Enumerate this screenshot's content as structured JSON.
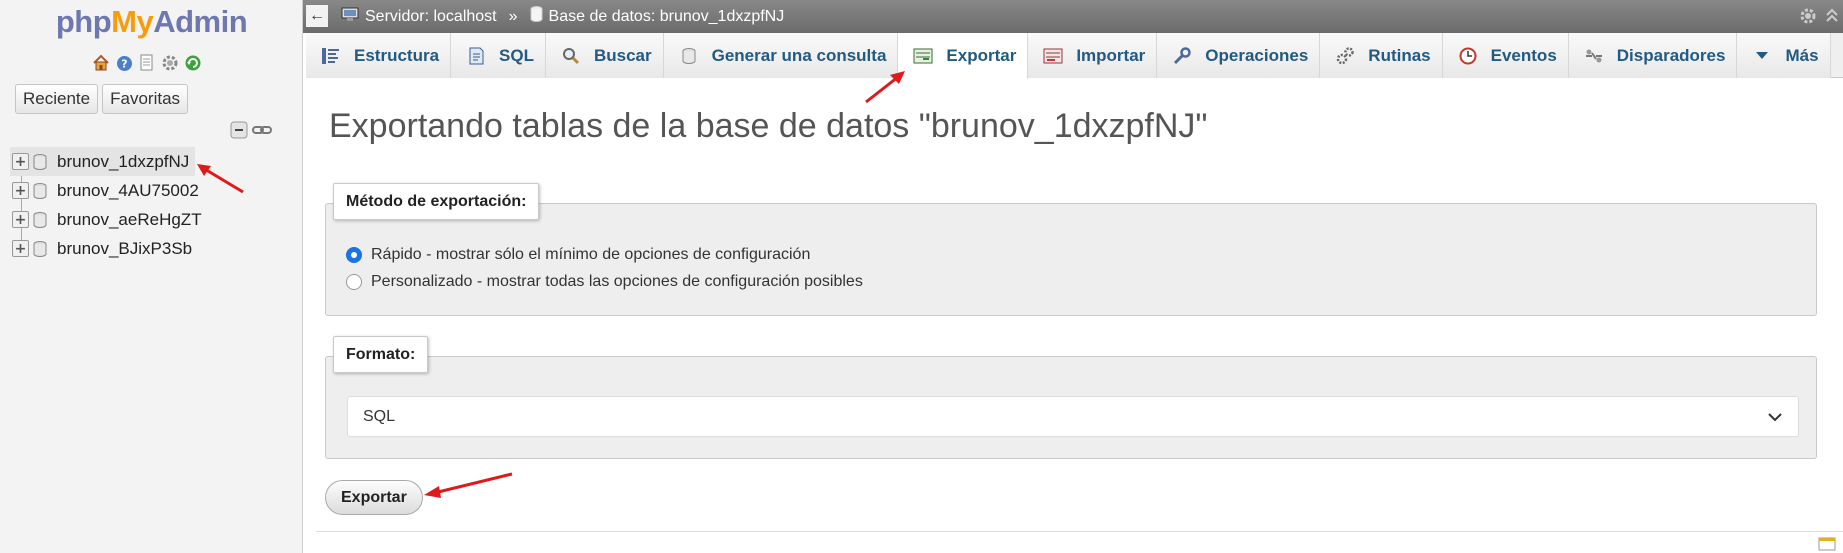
{
  "nav": {
    "logo": {
      "php": "php",
      "my": "My",
      "admin": "Admin"
    },
    "icons": [
      "home-icon",
      "help-icon",
      "docs-icon",
      "settings-icon",
      "reload-icon"
    ],
    "buttons": {
      "recent": "Reciente",
      "favorites": "Favoritas"
    },
    "tree_controls": [
      "collapse-all-icon",
      "link-icon"
    ],
    "databases": [
      {
        "name": "brunov_1dxzpfNJ",
        "active": true
      },
      {
        "name": "brunov_4AU75002",
        "active": false
      },
      {
        "name": "brunov_aeReHgZT",
        "active": false
      },
      {
        "name": "brunov_BJixP3Sb",
        "active": false
      }
    ]
  },
  "breadcrumb": {
    "server_label": "Servidor: localhost",
    "separator": "»",
    "database_label": "Base de datos: brunov_1dxzpfNJ"
  },
  "tabs": [
    {
      "label": "Estructura",
      "icon": "structure-icon",
      "active": false
    },
    {
      "label": "SQL",
      "icon": "sql-icon",
      "active": false
    },
    {
      "label": "Buscar",
      "icon": "search-icon",
      "active": false
    },
    {
      "label": "Generar una consulta",
      "icon": "query-icon",
      "active": false
    },
    {
      "label": "Exportar",
      "icon": "export-icon",
      "active": true
    },
    {
      "label": "Importar",
      "icon": "import-icon",
      "active": false
    },
    {
      "label": "Operaciones",
      "icon": "wrench-icon",
      "active": false
    },
    {
      "label": "Rutinas",
      "icon": "routines-icon",
      "active": false
    },
    {
      "label": "Eventos",
      "icon": "clock-icon",
      "active": false
    },
    {
      "label": "Disparadores",
      "icon": "triggers-icon",
      "active": false
    },
    {
      "label": "Más",
      "icon": "caret-down-icon",
      "active": false
    }
  ],
  "main": {
    "title": "Exportando tablas de la base de datos \"brunov_1dxzpfNJ\"",
    "method": {
      "legend": "Método de exportación:",
      "options": [
        {
          "label": "Rápido - mostrar sólo el mínimo de opciones de configuración",
          "checked": true
        },
        {
          "label": "Personalizado - mostrar todas las opciones de configuración posibles",
          "checked": false
        }
      ]
    },
    "format": {
      "legend": "Formato:",
      "selected": "SQL"
    },
    "export_button": "Exportar"
  },
  "colors": {
    "tab_text": "#235a81",
    "annotation_arrow": "#e0191b",
    "radio_checked": "#1a73e8"
  }
}
